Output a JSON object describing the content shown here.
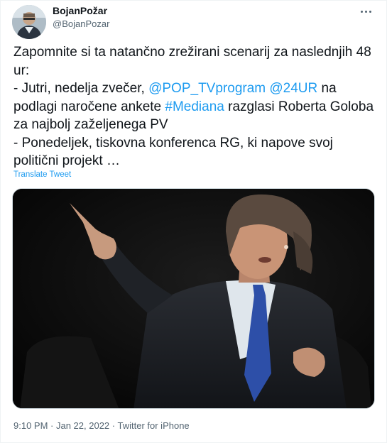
{
  "tweet": {
    "author": {
      "display_name": "BojanPožar",
      "handle": "@BojanPozar"
    },
    "more_icon": "more-horizontal-icon",
    "text": {
      "line1": "Zapomnite si ta natančno zrežirani scenarij za naslednjih 48 ur:",
      "line2_prefix": "- Jutri, nedelja zvečer, ",
      "mention1": "@POP_TVprogram",
      "space": " ",
      "mention2": "@24UR",
      "line2_middle": " na podlagi naročene ankete ",
      "hashtag": "#Mediana",
      "line2_suffix": " razglasi Roberta Goloba za najbolj zaželjenega PV",
      "line3": "- Ponedeljek, tiskovna konferenca RG, ki napove svoj politični projekt …"
    },
    "translate_label": "Translate Tweet",
    "time": "9:10 PM",
    "separator": " · ",
    "date": "Jan 22, 2022",
    "source": "Twitter for iPhone",
    "colors": {
      "text": "#0f1419",
      "secondary": "#536471",
      "link": "#1d9bf0"
    }
  }
}
